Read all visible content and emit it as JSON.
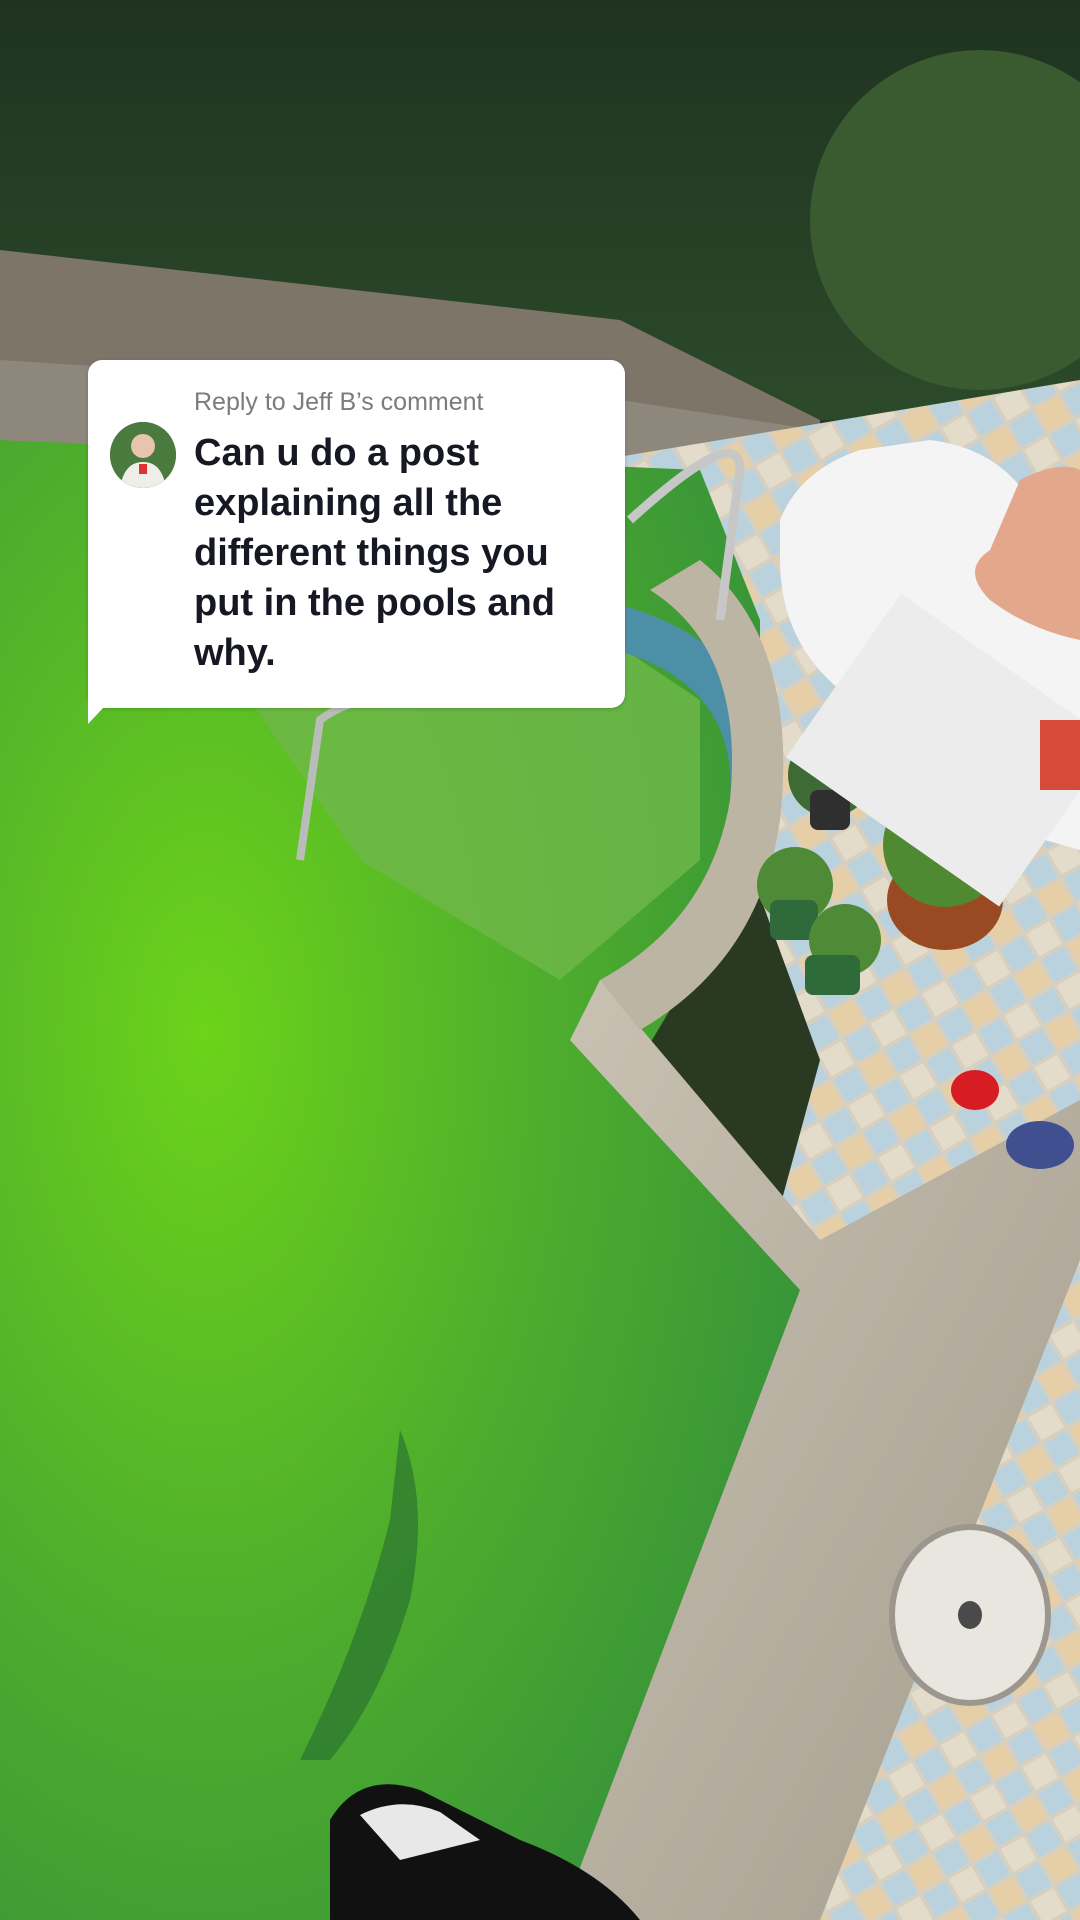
{
  "reply": {
    "header": "Reply to Jeff B’s comment",
    "text": "Can u do a post explaining all the different things you put in the pools and why."
  },
  "icons": {
    "avatar": "commenter-avatar"
  },
  "colors": {
    "bubble_bg": "#ffffff",
    "header_text": "#7b7b80",
    "body_text": "#161823",
    "pool_water": "#5fbf2a"
  }
}
